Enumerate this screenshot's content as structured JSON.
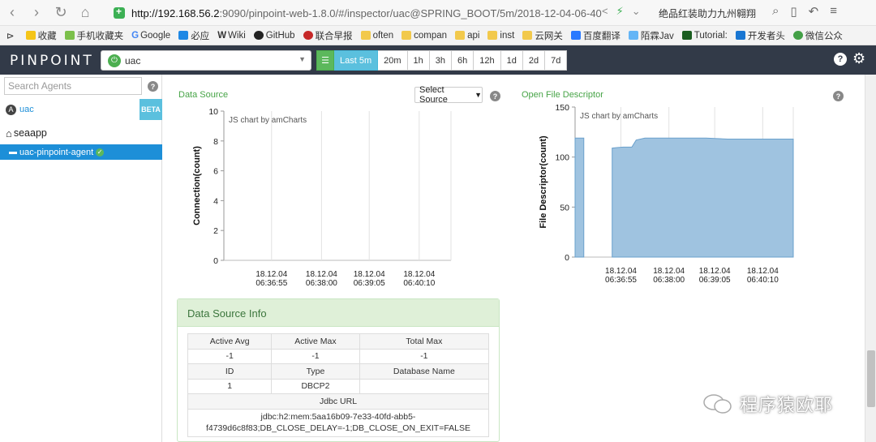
{
  "browser": {
    "url_host": "http://192.168.56.2",
    "url_rest": ":9090/pinpoint-web-1.8.0/#/inspector/uac@SPRING_BOOT/5m/2018-12-04-06-40",
    "search_promo": "绝品红装助力九州翱翔"
  },
  "bookmarks": [
    "收藏",
    "手机收藏夹",
    "Google",
    "必应",
    "Wiki",
    "GitHub",
    "联合早报",
    "often",
    "compan",
    "api",
    "inst",
    "云网关",
    "百度翻译",
    "陌霖Jav",
    "Tutorial:",
    "开发者头",
    "微信公众"
  ],
  "header": {
    "logo": "PINPOINT",
    "app_name": "uac",
    "ranges": [
      "Last 5m",
      "20m",
      "1h",
      "3h",
      "6h",
      "12h",
      "1d",
      "2d",
      "7d"
    ],
    "active_range": "Last 5m"
  },
  "sidebar": {
    "search_placeholder": "Search Agents",
    "app_label": "uac",
    "beta_label": "BETA",
    "host_label": "seaapp",
    "agent_label": "uac-pinpoint-agent"
  },
  "data_source": {
    "title": "Data Source",
    "select_label": "Select Source",
    "chart_credit": "JS chart by amCharts"
  },
  "fd_panel": {
    "title": "Open File Descriptor",
    "chart_credit": "JS chart by amCharts"
  },
  "chart_data": [
    {
      "type": "line",
      "title": "Data Source",
      "ylabel": "Connection(count)",
      "ylim": [
        0,
        10
      ],
      "yticks": [
        "0",
        "2",
        "4",
        "6",
        "8",
        "10"
      ],
      "x_labels": [
        [
          "18.12.04",
          "06:36:55"
        ],
        [
          "18.12.04",
          "06:38:00"
        ],
        [
          "18.12.04",
          "06:39:05"
        ],
        [
          "18.12.04",
          "06:40:10"
        ]
      ],
      "series": []
    },
    {
      "type": "area",
      "title": "Open File Descriptor",
      "ylabel": "File Descriptor(count)",
      "ylim": [
        0,
        150
      ],
      "yticks": [
        "0",
        "50",
        "100",
        "150"
      ],
      "x_labels": [
        [
          "18.12.04",
          "06:36:55"
        ],
        [
          "18.12.04",
          "06:38:00"
        ],
        [
          "18.12.04",
          "06:39:05"
        ],
        [
          "18.12.04",
          "06:40:10"
        ]
      ],
      "segments": [
        [
          [
            0.0,
            119
          ],
          [
            0.04,
            119
          ]
        ],
        [
          [
            0.17,
            109
          ],
          [
            0.22,
            110
          ],
          [
            0.26,
            110
          ],
          [
            0.28,
            117
          ],
          [
            0.32,
            119
          ],
          [
            0.5,
            119
          ],
          [
            0.6,
            119
          ],
          [
            0.7,
            118
          ],
          [
            0.85,
            118
          ],
          [
            1.0,
            118
          ]
        ]
      ],
      "fill": "#9fc3e0",
      "stroke": "#6aa0cc"
    }
  ],
  "info": {
    "title": "Data Source Info",
    "headers1": [
      "Active Avg",
      "Active Max",
      "Total Max"
    ],
    "values1": [
      "-1",
      "-1",
      "-1"
    ],
    "headers2": [
      "ID",
      "Type",
      "Database Name"
    ],
    "values2": [
      "1",
      "DBCP2",
      ""
    ],
    "jdbc_header": "Jdbc URL",
    "jdbc_url": "jdbc:h2:mem:5aa16b09-7e33-40fd-abb5-f4739d6c8f83;DB_CLOSE_DELAY=-1;DB_CLOSE_ON_EXIT=FALSE"
  },
  "watermark": "程序猿欧耶"
}
